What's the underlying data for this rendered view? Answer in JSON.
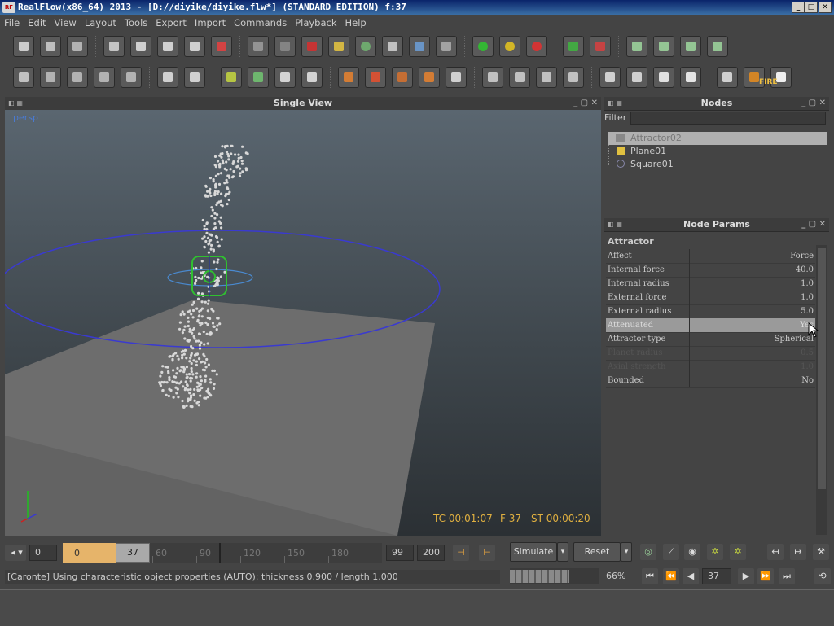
{
  "window": {
    "title": "RealFlow(x86_64) 2013 - [D://diyike/diyike.flw*] (STANDARD EDITION) f:37",
    "app_icon": "RF",
    "minimize": "_",
    "maximize": "□",
    "close": "✕"
  },
  "menu": [
    "File",
    "Edit",
    "View",
    "Layout",
    "Tools",
    "Export",
    "Import",
    "Commands",
    "Playback",
    "Help"
  ],
  "toolbar_row1": [
    {
      "name": "new-scene-icon",
      "color": "#d8d8d8"
    },
    {
      "name": "open-scene-icon",
      "color": "#c9c9c9"
    },
    {
      "name": "save-scene-icon",
      "color": "#bcbcbc"
    },
    {
      "name": "select-icon",
      "color": "#cfcfcf"
    },
    {
      "name": "move-icon",
      "color": "#dddddd"
    },
    {
      "name": "rotate-icon",
      "color": "#dddddd"
    },
    {
      "name": "scale-icon",
      "color": "#dddddd"
    },
    {
      "name": "axis-icon",
      "color": "#e04040"
    },
    {
      "name": "layer-icon",
      "color": "#9a9a9a"
    },
    {
      "name": "particle-icon",
      "color": "#888888"
    },
    {
      "name": "daemon-icon",
      "color": "#d03030"
    },
    {
      "name": "object-cube-icon",
      "color": "#e0c040"
    },
    {
      "name": "mesh-icon",
      "color": "#70b070"
    },
    {
      "name": "camera-icon",
      "color": "#cccccc"
    },
    {
      "name": "wave-icon",
      "color": "#6a9ad0"
    },
    {
      "name": "rbody-icon",
      "color": "#aaaaaa"
    },
    {
      "name": "green-light-icon",
      "color": "#30c030"
    },
    {
      "name": "yellow-light-icon",
      "color": "#e0c020"
    },
    {
      "name": "red-light-icon",
      "color": "#e03030"
    },
    {
      "name": "save-green-icon",
      "color": "#40b040"
    },
    {
      "name": "save-red-icon",
      "color": "#d04040"
    },
    {
      "name": "script-icon",
      "color": "#9ad09a"
    },
    {
      "name": "batch-icon",
      "color": "#9ad09a"
    },
    {
      "name": "timer-icon",
      "color": "#9ad09a"
    },
    {
      "name": "network-icon",
      "color": "#9ad09a"
    }
  ],
  "toolbar_row2": [
    {
      "name": "sheet-icon",
      "color": "#cccccc"
    },
    {
      "name": "add-node-icon",
      "color": "#bbbbbb"
    },
    {
      "name": "remove-node-icon",
      "color": "#bbbbbb"
    },
    {
      "name": "link-node-icon",
      "color": "#bbbbbb"
    },
    {
      "name": "unlink-node-icon",
      "color": "#bbbbbb"
    },
    {
      "name": "box-open-icon",
      "color": "#dddddd"
    },
    {
      "name": "box-closed-icon",
      "color": "#dddddd"
    },
    {
      "name": "clipboard-icon",
      "color": "#c0d040"
    },
    {
      "name": "dots-grid-icon",
      "color": "#70c070"
    },
    {
      "name": "ruler-icon",
      "color": "#e0e0e0"
    },
    {
      "name": "flower-icon",
      "color": "#e0e0e0"
    },
    {
      "name": "grid-orange-icon",
      "color": "#e08030"
    },
    {
      "name": "grid-red-icon",
      "color": "#e05030"
    },
    {
      "name": "grid-crack-icon",
      "color": "#d07030"
    },
    {
      "name": "grid-target-icon",
      "color": "#e08030"
    },
    {
      "name": "hourglass-icon",
      "color": "#dddddd"
    },
    {
      "name": "cube-wire-icon",
      "color": "#cccccc"
    },
    {
      "name": "cube-dots-icon",
      "color": "#cccccc"
    },
    {
      "name": "frame-dots-icon",
      "color": "#cccccc"
    },
    {
      "name": "burst-icon",
      "color": "#cccccc"
    },
    {
      "name": "cube-outline-icon",
      "color": "#dddddd"
    },
    {
      "name": "cube-shaded-icon",
      "color": "#dddddd"
    },
    {
      "name": "cube-solid-icon",
      "color": "#eeeeee"
    },
    {
      "name": "cube-white-icon",
      "color": "#f4f4f4"
    },
    {
      "name": "render-icon",
      "color": "#dddddd"
    },
    {
      "name": "fire-icon",
      "color": "#e08a20"
    },
    {
      "name": "flare-icon",
      "color": "#ffffff"
    }
  ],
  "fire_label": "FIRE",
  "viewport": {
    "title": "Single View",
    "camera": "persp",
    "tc": "TC 00:01:07",
    "frame": "F 37",
    "st": "ST 00:00:20"
  },
  "nodes": {
    "title": "Nodes",
    "filter_label": "Filter",
    "filter_value": "",
    "items": [
      {
        "label": "Attractor02",
        "icon": "attractor-icon",
        "selected": true
      },
      {
        "label": "Plane01",
        "icon": "plane-object-icon",
        "selected": false
      },
      {
        "label": "Square01",
        "icon": "square-emitter-icon",
        "selected": false
      }
    ]
  },
  "params": {
    "title": "Node Params",
    "section": "Attractor",
    "rows": [
      {
        "key": "Affect",
        "value": "Force",
        "state": "normal"
      },
      {
        "key": "Internal force",
        "value": "40.0",
        "state": "normal"
      },
      {
        "key": "Internal radius",
        "value": "1.0",
        "state": "normal"
      },
      {
        "key": "External force",
        "value": "1.0",
        "state": "normal"
      },
      {
        "key": "External radius",
        "value": "5.0",
        "state": "normal"
      },
      {
        "key": "Attenuated",
        "value": "Yes",
        "state": "highlight"
      },
      {
        "key": "Attractor type",
        "value": "Spherical",
        "state": "normal"
      },
      {
        "key": "Planet radius",
        "value": "0.5",
        "state": "disabled"
      },
      {
        "key": "Axial strength",
        "value": "1.0",
        "state": "disabled"
      },
      {
        "key": "Bounded",
        "value": "No",
        "state": "normal"
      }
    ]
  },
  "timeline": {
    "start": "0",
    "range_start": "0",
    "current": "37",
    "ticks": [
      "60",
      "90",
      "120",
      "150",
      "180"
    ],
    "end_frame": "99",
    "max_frame": "200",
    "current_ratio": 0.185
  },
  "sim": {
    "simulate": "Simulate",
    "reset": "Reset"
  },
  "status": {
    "message": "[Caronte] Using characteristic object properties (AUTO): thickness 0.900 / length 1.000",
    "progress_percent": "66%",
    "frame_field": "37"
  },
  "playback_icons": [
    "go-start-icon",
    "step-back-icon",
    "play-back-icon",
    "play-forward-icon",
    "step-forward-icon",
    "go-end-icon",
    "loop-icon"
  ],
  "colors": {
    "selection": "#b0b0b0",
    "accent_timecode": "#e0b040",
    "attractor_ring": "#3a3ad0",
    "attractor_core": "#30c030",
    "timeline_range": "#e6b46a"
  }
}
